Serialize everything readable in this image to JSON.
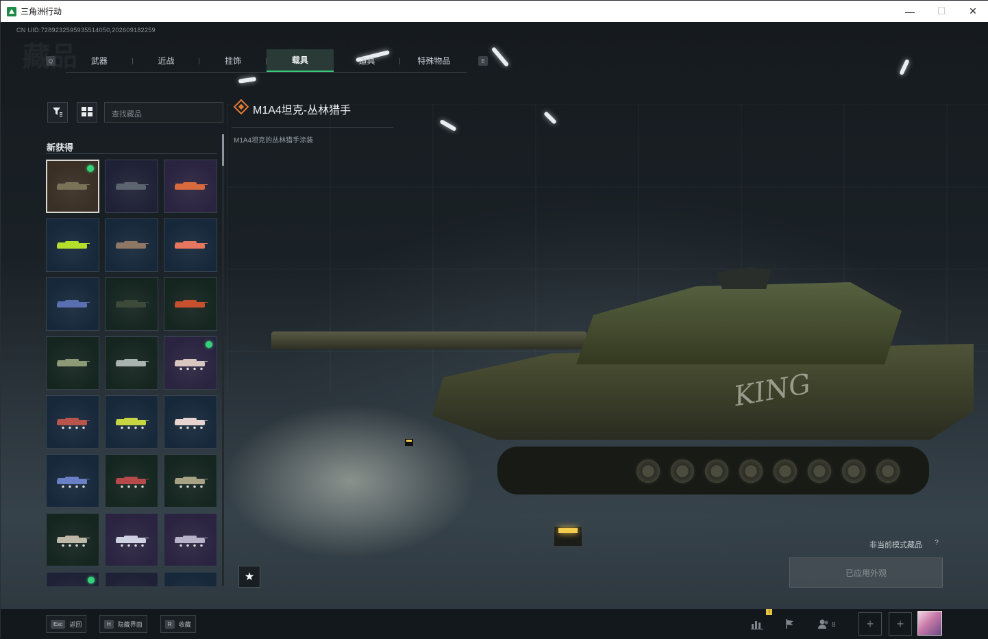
{
  "window": {
    "title": "三角洲行动",
    "minimize": "—",
    "maximize": "☐",
    "close": "✕"
  },
  "uid_text": "CN UID:728923259593551405​0,202609182259",
  "tabs": [
    {
      "label": "武器",
      "active": false
    },
    {
      "label": "近战",
      "active": false
    },
    {
      "label": "挂饰",
      "active": false
    },
    {
      "label": "载具",
      "active": true
    },
    {
      "label": "道具",
      "active": false
    },
    {
      "label": "特殊物品",
      "active": false
    }
  ],
  "tab_keys": {
    "left": "Q",
    "right": "E"
  },
  "toolbar": {
    "filter_icon": "filter-icon",
    "layout_icon": "grid-view-icon",
    "search_placeholder": "查找藏品"
  },
  "section": {
    "title": "新获得"
  },
  "items": [
    {
      "color": "#7a7358",
      "bg": "#3a2f25",
      "selected": true,
      "new": true,
      "wheeled": false
    },
    {
      "color": "#5c6470",
      "bg": "#1f2236",
      "selected": false,
      "new": false,
      "wheeled": false
    },
    {
      "color": "#d96a3d",
      "bg": "#2a2440",
      "selected": false,
      "new": false,
      "wheeled": false
    },
    {
      "color": "#b4e02c",
      "bg": "#16283a",
      "selected": false,
      "new": false,
      "wheeled": false
    },
    {
      "color": "#8f7766",
      "bg": "#16283a",
      "selected": false,
      "new": false,
      "wheeled": false
    },
    {
      "color": "#e6765e",
      "bg": "#16283a",
      "selected": false,
      "new": false,
      "wheeled": false
    },
    {
      "color": "#5a6fb0",
      "bg": "#16283a",
      "selected": false,
      "new": false,
      "wheeled": false
    },
    {
      "color": "#3d4a3a",
      "bg": "#15251f",
      "selected": false,
      "new": false,
      "wheeled": false
    },
    {
      "color": "#c7502f",
      "bg": "#15251f",
      "selected": false,
      "new": false,
      "wheeled": false
    },
    {
      "color": "#8c9a78",
      "bg": "#15251f",
      "selected": false,
      "new": false,
      "wheeled": false
    },
    {
      "color": "#a9b3b0",
      "bg": "#15251f",
      "selected": false,
      "new": false,
      "wheeled": false
    },
    {
      "color": "#d8c7c0",
      "bg": "#2a2440",
      "selected": false,
      "new": true,
      "wheeled": true
    },
    {
      "color": "#b8544c",
      "bg": "#16283a",
      "selected": false,
      "new": false,
      "wheeled": true
    },
    {
      "color": "#c8d642",
      "bg": "#16283a",
      "selected": false,
      "new": false,
      "wheeled": true
    },
    {
      "color": "#e7d4d0",
      "bg": "#16283a",
      "selected": false,
      "new": false,
      "wheeled": true
    },
    {
      "color": "#6a7fc4",
      "bg": "#16283a",
      "selected": false,
      "new": false,
      "wheeled": true
    },
    {
      "color": "#b64a4a",
      "bg": "#15251f",
      "selected": false,
      "new": false,
      "wheeled": true
    },
    {
      "color": "#a7a286",
      "bg": "#15251f",
      "selected": false,
      "new": false,
      "wheeled": true
    },
    {
      "color": "#bdb8a8",
      "bg": "#15251f",
      "selected": false,
      "new": false,
      "wheeled": true
    },
    {
      "color": "#cfd2e2",
      "bg": "#2a2440",
      "selected": false,
      "new": false,
      "wheeled": true
    },
    {
      "color": "#b8b2c8",
      "bg": "#2a2440",
      "selected": false,
      "new": false,
      "wheeled": true
    },
    {
      "color": "#3a4d8a",
      "bg": "#1f2236",
      "selected": false,
      "new": true,
      "wheeled": false
    },
    {
      "color": "#3a4d8a",
      "bg": "#1f2236",
      "selected": false,
      "new": false,
      "wheeled": false
    },
    {
      "color": "#3a4d8a",
      "bg": "#16283a",
      "selected": false,
      "new": false,
      "wheeled": false
    }
  ],
  "detail": {
    "name": "M1A4坦克-丛林猎手",
    "description": "M1A4坦克的丛林猎手涂装",
    "rarity_color": "#e37a35",
    "tank_marking": "KING"
  },
  "favorite_icon": "★",
  "non_mode_label": "非当前模式藏品",
  "help_icon": "?",
  "apply_button": "已应用外观",
  "bottom_hints": [
    {
      "key": "Esc",
      "label": "返回"
    },
    {
      "key": "H",
      "label": "隐藏界面"
    },
    {
      "key": "R",
      "label": "收藏"
    }
  ],
  "bottom_icons": {
    "stats_badge": "!",
    "friends_count": "8"
  }
}
